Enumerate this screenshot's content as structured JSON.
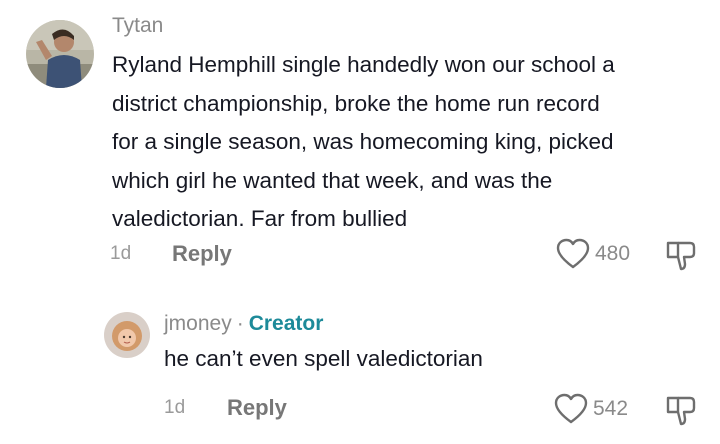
{
  "comments": [
    {
      "username": "Tytan",
      "text_lines": [
        "Ryland Hemphill single handedly won our school a",
        "district championship, broke the home run record",
        "for a single season, was homecoming king, picked",
        "which girl he wanted that week, and was the",
        "valedictorian. Far from bullied"
      ],
      "time": "1d",
      "reply_label": "Reply",
      "likes": "480"
    }
  ],
  "reply": {
    "username": "jmoney",
    "separator": "·",
    "badge": "Creator",
    "text": "he can’t even spell valedictorian",
    "time": "1d",
    "reply_label": "Reply",
    "likes": "542"
  },
  "icons": {
    "like": "heart-icon",
    "dislike": "thumbs-down-icon"
  },
  "colors": {
    "text": "#161823",
    "muted": "#8a8a8a",
    "creator_badge": "#1d8a99"
  }
}
